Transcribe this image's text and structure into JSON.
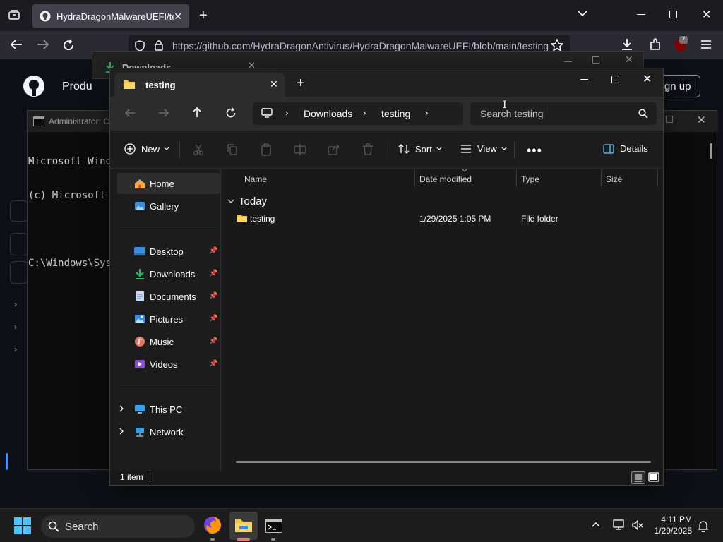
{
  "browser": {
    "tab_title": "HydraDragonMalwareUEFI/test",
    "url": "https://github.com/HydraDragonAntivirus/HydraDragonMalwareUEFI/blob/main/testing",
    "extension_badge": "7"
  },
  "github": {
    "nav_item": "Produ",
    "signup_label": "ign up"
  },
  "cmd": {
    "title": "Administrator: C",
    "lines": [
      "Microsoft Windo",
      "(c) Microsoft C",
      "",
      "C:\\Windows\\Syst"
    ]
  },
  "ghost_downloads": {
    "title": "Downloads"
  },
  "explorer": {
    "tab_title": "testing",
    "breadcrumb": [
      "Downloads",
      "testing"
    ],
    "search_placeholder": "Search testing",
    "toolbar": {
      "new_label": "New",
      "sort_label": "Sort",
      "view_label": "View",
      "details_label": "Details"
    },
    "nav": {
      "home": "Home",
      "gallery": "Gallery",
      "desktop": "Desktop",
      "downloads": "Downloads",
      "documents": "Documents",
      "pictures": "Pictures",
      "music": "Music",
      "videos": "Videos",
      "this_pc": "This PC",
      "network": "Network"
    },
    "columns": [
      "Name",
      "Date modified",
      "Type",
      "Size"
    ],
    "group_label": "Today",
    "files": [
      {
        "name": "testing",
        "date": "1/29/2025 1:05 PM",
        "type": "File folder",
        "size": ""
      }
    ],
    "status": "1 item"
  },
  "taskbar": {
    "search_label": "Search",
    "time": "4:11 PM",
    "date": "1/29/2025"
  }
}
